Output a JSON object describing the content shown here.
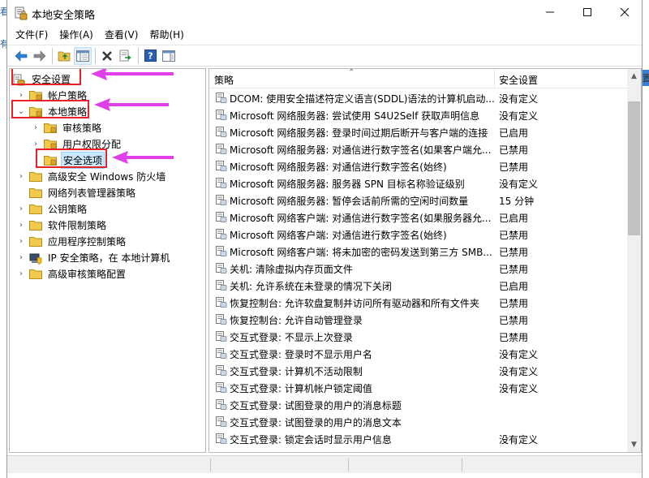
{
  "window": {
    "title": "本地安全策略",
    "menu": [
      "文件(F)",
      "操作(A)",
      "查看(V)",
      "帮助(H)"
    ]
  },
  "bg_fragments": [
    "看",
    "有",
    "置"
  ],
  "tree": {
    "root": "安全设置",
    "items": [
      {
        "label": "帐户策略",
        "level": 1,
        "expanded": false
      },
      {
        "label": "本地策略",
        "level": 1,
        "expanded": true
      },
      {
        "label": "审核策略",
        "level": 2,
        "expanded": false
      },
      {
        "label": "用户权限分配",
        "level": 2,
        "expanded": false
      },
      {
        "label": "安全选项",
        "level": 2,
        "selected": true
      },
      {
        "label": "高级安全 Windows 防火墙",
        "level": 1
      },
      {
        "label": "网络列表管理器策略",
        "level": 1
      },
      {
        "label": "公钥策略",
        "level": 1
      },
      {
        "label": "软件限制策略",
        "level": 1
      },
      {
        "label": "应用程序控制策略",
        "level": 1
      },
      {
        "label": "IP 安全策略，在 本地计算机",
        "level": 1
      },
      {
        "label": "高级审核策略配置",
        "level": 1
      }
    ]
  },
  "list": {
    "columns": [
      "策略",
      "安全设置"
    ],
    "rows": [
      {
        "name": "DCOM: 使用安全描述符定义语言(SDDL)语法的计算机启动...",
        "value": "没有定义"
      },
      {
        "name": "Microsoft 网络服务器: 尝试使用 S4U2Self 获取声明信息",
        "value": "没有定义"
      },
      {
        "name": "Microsoft 网络服务器: 登录时间过期后断开与客户端的连接",
        "value": "已启用"
      },
      {
        "name": "Microsoft 网络服务器: 对通信进行数字签名(如果客户端允...",
        "value": "已禁用"
      },
      {
        "name": "Microsoft 网络服务器: 对通信进行数字签名(始终)",
        "value": "已禁用"
      },
      {
        "name": "Microsoft 网络服务器: 服务器 SPN 目标名称验证级别",
        "value": "没有定义"
      },
      {
        "name": "Microsoft 网络服务器: 暂停会话前所需的空闲时间数量",
        "value": "15 分钟"
      },
      {
        "name": "Microsoft 网络客户端: 对通信进行数字签名(如果服务器允...",
        "value": "已启用"
      },
      {
        "name": "Microsoft 网络客户端: 对通信进行数字签名(始终)",
        "value": "已禁用"
      },
      {
        "name": "Microsoft 网络客户端: 将未加密的密码发送到第三方 SMB...",
        "value": "已禁用"
      },
      {
        "name": "关机: 清除虚拟内存页面文件",
        "value": "已禁用"
      },
      {
        "name": "关机: 允许系统在未登录的情况下关闭",
        "value": "已启用"
      },
      {
        "name": "恢复控制台: 允许软盘复制并访问所有驱动器和所有文件夹",
        "value": "已禁用"
      },
      {
        "name": "恢复控制台: 允许自动管理登录",
        "value": "已禁用"
      },
      {
        "name": "交互式登录: 不显示上次登录",
        "value": "已禁用"
      },
      {
        "name": "交互式登录: 登录时不显示用户名",
        "value": "没有定义"
      },
      {
        "name": "交互式登录: 计算机不活动限制",
        "value": "没有定义"
      },
      {
        "name": "交互式登录: 计算机帐户锁定阈值",
        "value": "没有定义"
      },
      {
        "name": "交互式登录: 试图登录的用户的消息标题",
        "value": ""
      },
      {
        "name": "交互式登录: 试图登录的用户的消息文本",
        "value": ""
      },
      {
        "name": "交互式登录: 锁定会话时显示用户信息",
        "value": "没有定义"
      }
    ]
  },
  "colors": {
    "highlight_box": "#e8212b",
    "annotation_arrow": "#e040e8",
    "selection": "#cce8ff"
  }
}
